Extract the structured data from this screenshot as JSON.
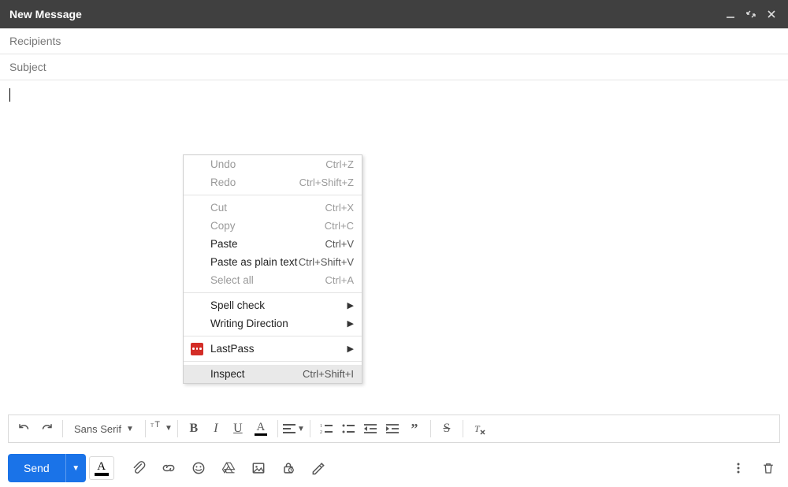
{
  "titlebar": {
    "title": "New Message"
  },
  "fields": {
    "recipients_placeholder": "Recipients",
    "subject_placeholder": "Subject"
  },
  "compose": {
    "body": ""
  },
  "toolbar": {
    "font_name": "Sans Serif"
  },
  "send": {
    "label": "Send"
  },
  "context_menu": {
    "items": [
      {
        "label": "Undo",
        "shortcut": "Ctrl+Z",
        "disabled": true
      },
      {
        "label": "Redo",
        "shortcut": "Ctrl+Shift+Z",
        "disabled": true
      },
      {
        "separator": true
      },
      {
        "label": "Cut",
        "shortcut": "Ctrl+X",
        "disabled": true
      },
      {
        "label": "Copy",
        "shortcut": "Ctrl+C",
        "disabled": true
      },
      {
        "label": "Paste",
        "shortcut": "Ctrl+V"
      },
      {
        "label": "Paste as plain text",
        "shortcut": "Ctrl+Shift+V"
      },
      {
        "label": "Select all",
        "shortcut": "Ctrl+A",
        "disabled": true
      },
      {
        "separator": true
      },
      {
        "label": "Spell check",
        "submenu": true
      },
      {
        "label": "Writing Direction",
        "submenu": true
      },
      {
        "separator": true
      },
      {
        "label": "LastPass",
        "submenu": true,
        "icon": "lastpass"
      },
      {
        "separator": true
      },
      {
        "label": "Inspect",
        "shortcut": "Ctrl+Shift+I",
        "hover": true
      }
    ]
  }
}
